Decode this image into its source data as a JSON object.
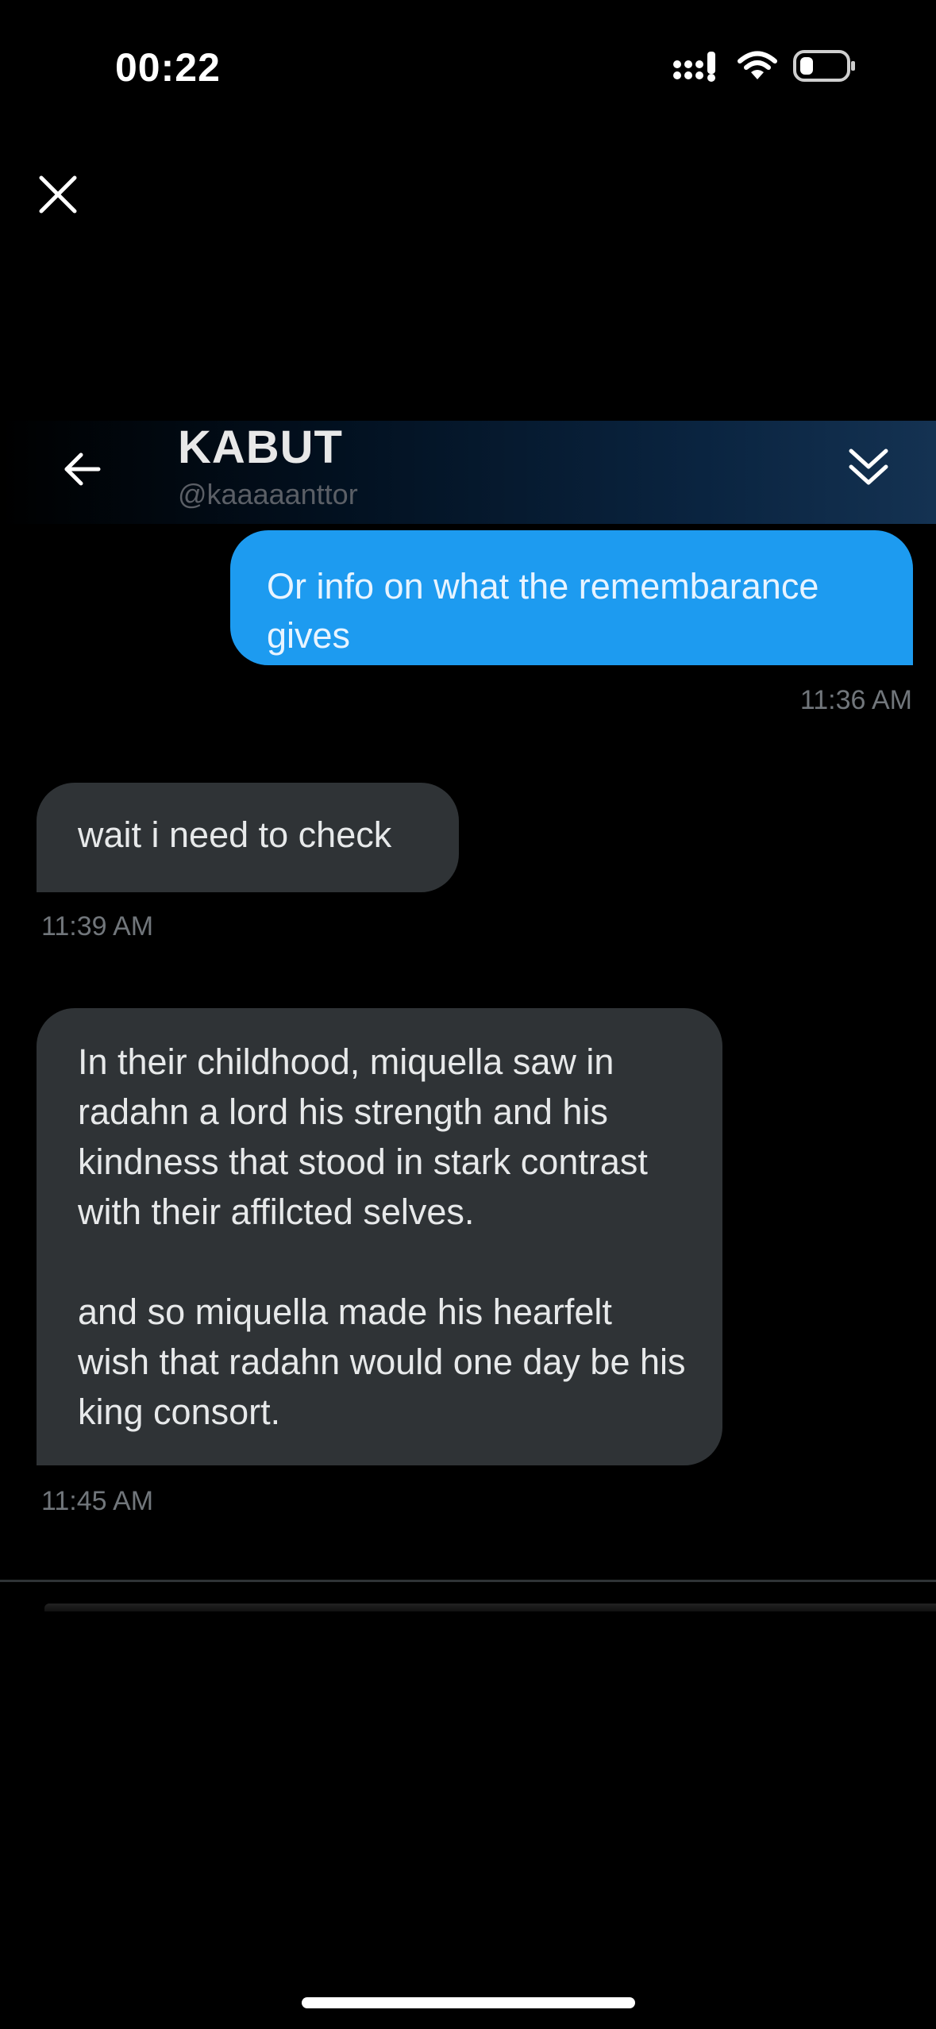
{
  "status_bar": {
    "time": "00:22"
  },
  "header": {
    "name": "KABUT",
    "handle": "@kaaaaanttor"
  },
  "messages": [
    {
      "direction": "outgoing",
      "text": "Or info on what the remembarance gives",
      "time": "11:36 AM"
    },
    {
      "direction": "incoming",
      "text": "wait i need to check",
      "time": "11:39 AM"
    },
    {
      "direction": "incoming",
      "paragraphs": [
        "In their childhood, miquella saw in radahn a lord his strength and his kindness that stood in stark contrast with their affilcted selves.",
        "and so miquella made his hearfelt wish that radahn would one day be his king consort."
      ],
      "time": "11:45 AM"
    }
  ],
  "icons": {
    "close": "close-icon",
    "back": "back-arrow-icon",
    "collapse": "double-chevron-down-icon",
    "signal": "signal-icon",
    "wifi": "wifi-icon",
    "battery": "battery-icon"
  },
  "colors": {
    "outgoing_bubble": "#1d9bf0",
    "incoming_bubble": "#2f3336",
    "timestamp": "#71767b"
  }
}
